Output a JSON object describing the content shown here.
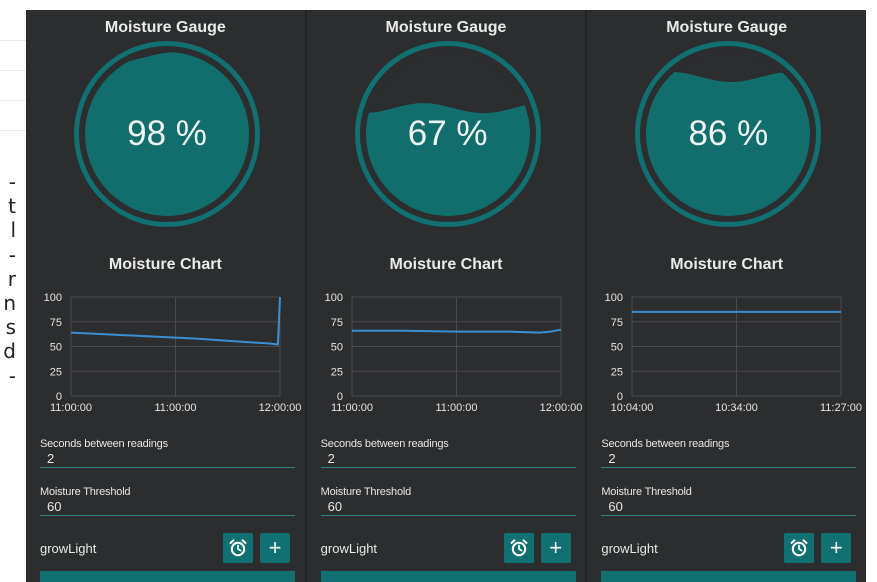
{
  "colors": {
    "accent": "#117072",
    "gauge_fill": "#116e6d",
    "panel_bg": "#2c2d2e",
    "line": "#3a8fd4",
    "text": "#e9ebea",
    "grid": "#4a4b4c"
  },
  "left_edge": {
    "fragment_lines": [
      "-",
      "t",
      "l",
      "-",
      "r",
      "n",
      "s",
      "d",
      "-"
    ]
  },
  "panels": [
    {
      "gauge": {
        "title": "Moisture Gauge",
        "value": "98 %",
        "level": 0.98
      },
      "chart": {
        "title": "Moisture Chart",
        "y_ticks": [
          "100",
          "75",
          "50",
          "25",
          "0"
        ],
        "x_ticks": [
          "11:00:00",
          "11:00:00",
          "12:00:00"
        ]
      },
      "seconds": {
        "label": "Seconds between readings",
        "value": "2"
      },
      "threshold": {
        "label": "Moisture Threshold",
        "value": "60"
      },
      "device": {
        "label": "growLight"
      },
      "buttons": {
        "alarm_icon": "alarm-clock-icon",
        "plus": "+"
      }
    },
    {
      "gauge": {
        "title": "Moisture Gauge",
        "value": "67 %",
        "level": 0.67
      },
      "chart": {
        "title": "Moisture Chart",
        "y_ticks": [
          "100",
          "75",
          "50",
          "25",
          "0"
        ],
        "x_ticks": [
          "11:00:00",
          "11:00:00",
          "12:00:00"
        ]
      },
      "seconds": {
        "label": "Seconds between readings",
        "value": "2"
      },
      "threshold": {
        "label": "Moisture Threshold",
        "value": "60"
      },
      "device": {
        "label": "growLight"
      },
      "buttons": {
        "alarm_icon": "alarm-clock-icon",
        "plus": "+"
      }
    },
    {
      "gauge": {
        "title": "Moisture Gauge",
        "value": "86 %",
        "level": 0.86
      },
      "chart": {
        "title": "Moisture Chart",
        "y_ticks": [
          "100",
          "75",
          "50",
          "25",
          "0"
        ],
        "x_ticks": [
          "10:04:00",
          "10:34:00",
          "11:27:00"
        ]
      },
      "seconds": {
        "label": "Seconds between readings",
        "value": "2"
      },
      "threshold": {
        "label": "Moisture Threshold",
        "value": "60"
      },
      "device": {
        "label": "growLight"
      },
      "buttons": {
        "alarm_icon": "alarm-clock-icon",
        "plus": "+"
      }
    }
  ],
  "chart_data": [
    {
      "type": "line",
      "title": "Moisture Chart",
      "ylim": [
        0,
        100
      ],
      "x_ticks": [
        "11:00:00",
        "11:00:00",
        "12:00:00"
      ],
      "series": [
        {
          "x": [
            0,
            0.2,
            0.4,
            0.6,
            0.8,
            0.95,
            0.99,
            1.0
          ],
          "y": [
            64,
            62,
            60,
            58,
            55,
            53,
            52,
            100
          ]
        }
      ]
    },
    {
      "type": "line",
      "title": "Moisture Chart",
      "ylim": [
        0,
        100
      ],
      "x_ticks": [
        "11:00:00",
        "11:00:00",
        "12:00:00"
      ],
      "series": [
        {
          "x": [
            0,
            0.25,
            0.5,
            0.75,
            0.9,
            0.95,
            1.0
          ],
          "y": [
            66,
            66,
            65,
            65,
            64,
            65,
            67
          ]
        }
      ]
    },
    {
      "type": "line",
      "title": "Moisture Chart",
      "ylim": [
        0,
        100
      ],
      "x_ticks": [
        "10:04:00",
        "10:34:00",
        "11:27:00"
      ],
      "series": [
        {
          "x": [
            0,
            0.25,
            0.5,
            0.75,
            1.0
          ],
          "y": [
            85,
            85,
            85,
            85,
            85
          ]
        }
      ]
    }
  ]
}
